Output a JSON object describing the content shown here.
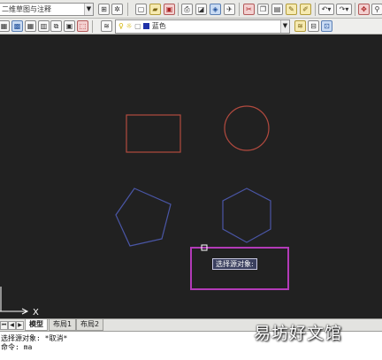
{
  "toolbar": {
    "workspace_combo": "二维草图与注释",
    "layer_combo": "蓝色",
    "icons_row1": [
      "qnew-icon",
      "open-icon",
      "save-icon",
      "plot-icon",
      "preview-icon",
      "publish-icon",
      "cut-icon",
      "copy-icon",
      "paste-icon",
      "matchprop-icon",
      "undo-icon",
      "redo-icon",
      "pan-icon",
      "zoom-icon"
    ],
    "icons_row2": [
      "layer-manager-icon",
      "layer-state-icon",
      "layer-freeze-icon",
      "lightbulb-icon",
      "sun-icon",
      "lock-icon",
      "color-swatch-icon",
      "layer-prev-icon",
      "layer-iso-icon"
    ]
  },
  "canvas": {
    "tooltip": "选择源对象:",
    "ucs_axis_label": "X",
    "shapes": [
      "rectangle",
      "circle",
      "pentagon",
      "hexagon",
      "selection-rectangle"
    ],
    "colors": {
      "rectangle": "#b24a3f",
      "circle": "#b24a3f",
      "pentagon": "#4a56a6",
      "hexagon": "#4a56a6",
      "selection": "#b33ab8",
      "background": "#212121"
    }
  },
  "tabs": [
    {
      "label": "模型",
      "active": true
    },
    {
      "label": "布局1",
      "active": false
    },
    {
      "label": "布局2",
      "active": false
    }
  ],
  "command": {
    "line1": "选择源对象: *取消*",
    "line2": "命令: ma"
  },
  "watermark": "易坊好文馆"
}
